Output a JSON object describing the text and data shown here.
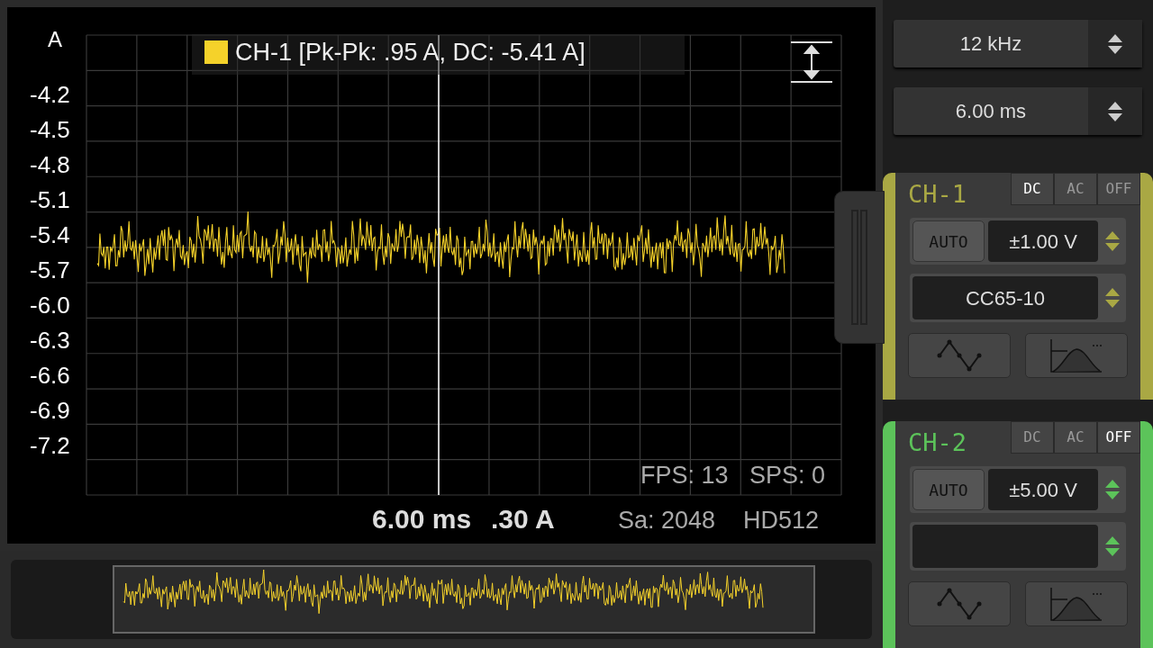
{
  "scope": {
    "unit_label": "A",
    "y_labels": [
      "-4.2",
      "-4.5",
      "-4.8",
      "-5.1",
      "-5.4",
      "-5.7",
      "-6.0",
      "-6.3",
      "-6.6",
      "-6.9",
      "-7.2"
    ],
    "legend": "CH-1 [Pk-Pk: .95 A, DC: -5.41 A]",
    "fps": "FPS: 13",
    "sps": "SPS: 0",
    "timebase": "6.00 ms",
    "scale": ".30 A",
    "samples": "Sa: 2048",
    "mode": "HD512"
  },
  "controls": [
    {
      "value": "12 kHz"
    },
    {
      "value": "6.00 ms"
    }
  ],
  "channels": [
    {
      "name": "CH-1",
      "color": "#a9a844",
      "handle": true,
      "couplings": [
        {
          "label": "DC",
          "selected": true
        },
        {
          "label": "AC",
          "selected": false
        },
        {
          "label": "OFF",
          "selected": false
        }
      ],
      "auto": "AUTO",
      "range": "±1.00 V",
      "probe": "CC65-10"
    },
    {
      "name": "CH-2",
      "color": "#5cc35a",
      "handle": false,
      "couplings": [
        {
          "label": "DC",
          "selected": false
        },
        {
          "label": "AC",
          "selected": false
        },
        {
          "label": "OFF",
          "selected": true
        }
      ],
      "auto": "AUTO",
      "range": "±5.00 V"
    }
  ]
}
